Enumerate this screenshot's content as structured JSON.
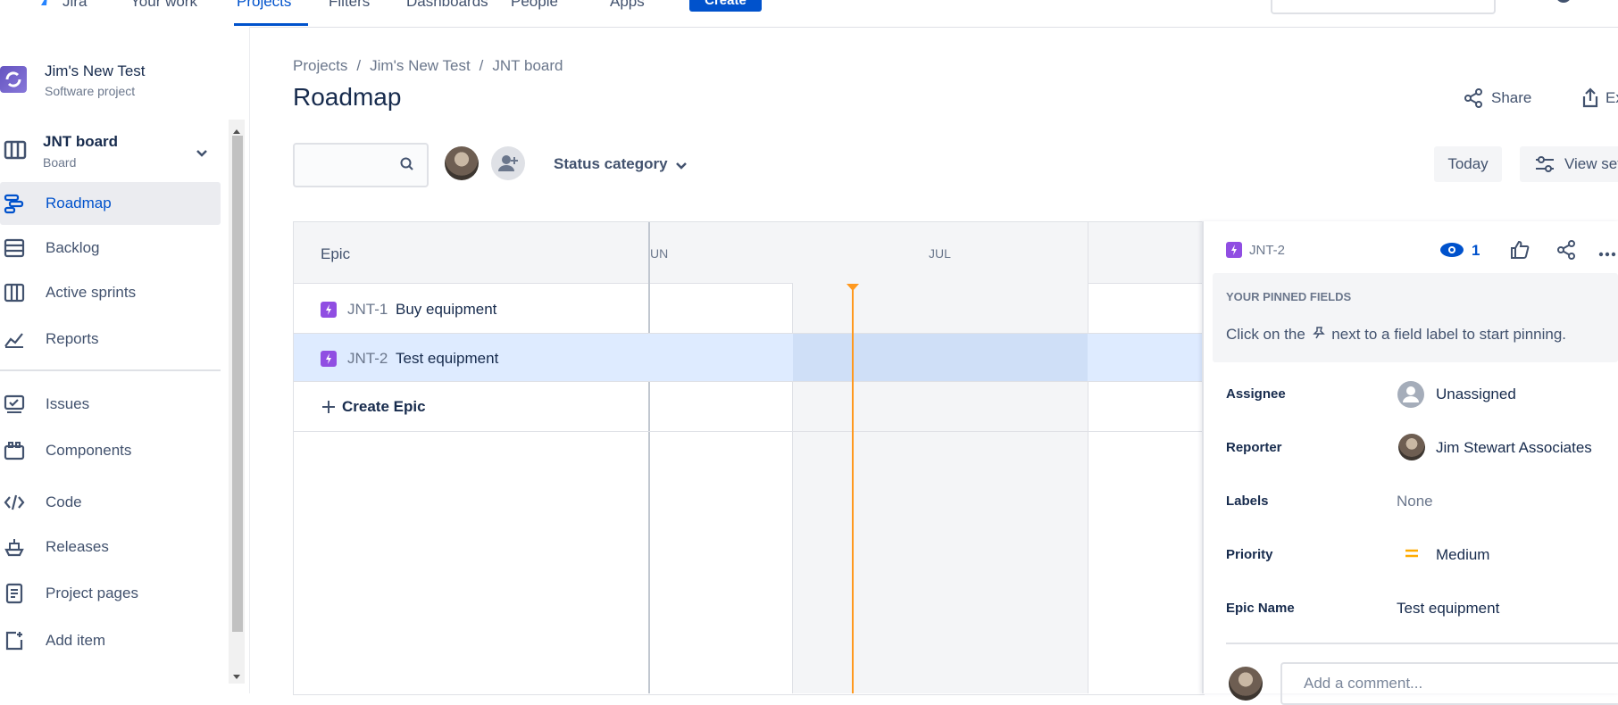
{
  "topnav": {
    "logo": "Jira",
    "items": [
      "Your work",
      "Projects",
      "Filters",
      "Dashboards",
      "People",
      "Apps"
    ],
    "active": "Projects",
    "create_label": "Create"
  },
  "sidebar": {
    "project_name": "Jim's New Test",
    "project_type": "Software project",
    "board_name": "JNT board",
    "board_sub": "Board",
    "items": [
      {
        "label": "Roadmap",
        "icon": "roadmap-icon"
      },
      {
        "label": "Backlog",
        "icon": "backlog-icon"
      },
      {
        "label": "Active sprints",
        "icon": "board-icon"
      },
      {
        "label": "Reports",
        "icon": "reports-icon"
      },
      {
        "label": "Issues",
        "icon": "issues-icon"
      },
      {
        "label": "Components",
        "icon": "components-icon"
      },
      {
        "label": "Code",
        "icon": "code-icon"
      },
      {
        "label": "Releases",
        "icon": "releases-icon"
      },
      {
        "label": "Project pages",
        "icon": "pages-icon"
      },
      {
        "label": "Add item",
        "icon": "add-item-icon"
      }
    ],
    "selected": "Roadmap"
  },
  "main": {
    "breadcrumb": [
      "Projects",
      "Jim's New Test",
      "JNT board"
    ],
    "title": "Roadmap",
    "share_label": "Share",
    "export_label": "Ex",
    "status_category_label": "Status category",
    "today_label": "Today",
    "view_settings_label": "View set"
  },
  "roadmap": {
    "epic_header": "Epic",
    "months": [
      "JUN",
      "JUL"
    ],
    "month_partial": "UN",
    "epics": [
      {
        "key": "JNT-1",
        "summary": "Buy equipment"
      },
      {
        "key": "JNT-2",
        "summary": "Test equipment"
      }
    ],
    "create_epic_label": "Create Epic"
  },
  "detail": {
    "issue_key": "JNT-2",
    "watch_count": "1",
    "pinned_title": "YOUR PINNED FIELDS",
    "pinned_hint_before": "Click on the",
    "pinned_hint_after": "next to a field label to start pinning.",
    "fields": [
      {
        "label": "Assignee",
        "value": "Unassigned"
      },
      {
        "label": "Reporter",
        "value": "Jim Stewart Associates"
      },
      {
        "label": "Labels",
        "value": "None"
      },
      {
        "label": "Priority",
        "value": "Medium"
      },
      {
        "label": "Epic Name",
        "value": "Test equipment"
      }
    ],
    "comment_placeholder": "Add a comment..."
  },
  "colors": {
    "accent": "#0052cc",
    "epic": "#904ee2",
    "today": "#ff991f",
    "priority_medium": "#ffab00"
  }
}
